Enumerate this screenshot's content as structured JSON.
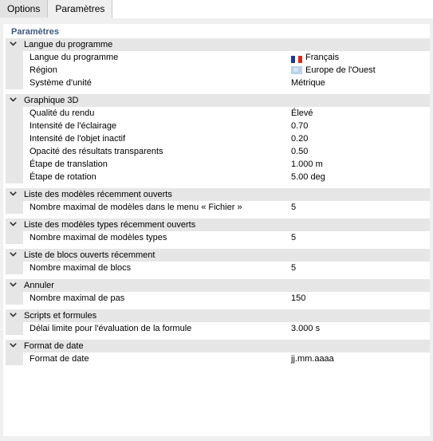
{
  "tabs": [
    {
      "label": "Options",
      "active": false
    },
    {
      "label": "Paramètres",
      "active": true
    }
  ],
  "panel_title": "Paramètres",
  "groups": [
    {
      "title": "Langue du programme",
      "rows": [
        {
          "label": "Langue du programme",
          "value": "Français",
          "icon": "flag-fr-icon"
        },
        {
          "label": "Région",
          "value": "Europe de l'Ouest",
          "icon": "map-region-icon"
        },
        {
          "label": "Système d'unité",
          "value": "Métrique"
        }
      ]
    },
    {
      "title": "Graphique 3D",
      "rows": [
        {
          "label": "Qualité du rendu",
          "value": "Élevé"
        },
        {
          "label": "Intensité de l'éclairage",
          "value": "0.70"
        },
        {
          "label": "Intensité de l'objet inactif",
          "value": "0.20"
        },
        {
          "label": "Opacité des résultats transparents",
          "value": "0.50"
        },
        {
          "label": "Étape de translation",
          "value": "1.000 m"
        },
        {
          "label": "Étape de rotation",
          "value": "5.00 deg"
        }
      ]
    },
    {
      "title": "Liste des modèles récemment ouverts",
      "rows": [
        {
          "label": "Nombre maximal de modèles dans le menu « Fichier »",
          "value": "5"
        }
      ]
    },
    {
      "title": "Liste des modèles types récemment ouverts",
      "rows": [
        {
          "label": "Nombre maximal de modèles types",
          "value": "5"
        }
      ]
    },
    {
      "title": "Liste de blocs ouverts récemment",
      "rows": [
        {
          "label": "Nombre maximal de blocs",
          "value": "5"
        }
      ]
    },
    {
      "title": "Annuler",
      "rows": [
        {
          "label": "Nombre maximal de pas",
          "value": "150"
        }
      ]
    },
    {
      "title": "Scripts et formules",
      "rows": [
        {
          "label": "Délai limite pour l'évaluation de la formule",
          "value": "3.000 s"
        }
      ]
    },
    {
      "title": "Format de date",
      "rows": [
        {
          "label": "Format de date",
          "value": "jj.mm.aaaa"
        }
      ]
    }
  ],
  "colors": {
    "flag_blue": "#1f3a93",
    "flag_white": "#ffffff",
    "flag_red": "#d52b1e",
    "title_blue": "#3c5a82"
  }
}
